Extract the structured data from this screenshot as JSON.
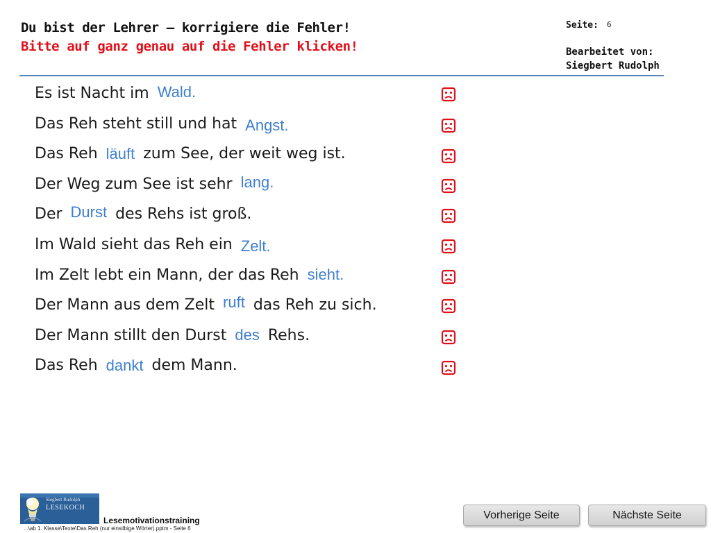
{
  "header": {
    "title": "Du bist der Lehrer – korrigiere die Fehler!",
    "subtitle": "Bitte auf ganz genau auf die Fehler klicken!",
    "page_label": "Seite:",
    "page_number": "6",
    "editor_label": "Bearbeitet von:",
    "editor_name": "Siegbert Rudolph"
  },
  "sentences": [
    {
      "before": "Es ist Nacht im",
      "word": "Wald.",
      "after": "",
      "mark": "sad-face-icon"
    },
    {
      "before": "Das Reh steht still und hat",
      "word": "Angst.",
      "after": "",
      "mark": "sad-face-icon"
    },
    {
      "before": "Das Reh",
      "word": "läuft",
      "after": "zum See, der weit weg ist.",
      "mark": "sad-face-icon"
    },
    {
      "before": "Der Weg zum See ist sehr",
      "word": "lang.",
      "after": "",
      "mark": "sad-face-icon"
    },
    {
      "before": "Der",
      "word": "Durst",
      "after": "des Rehs ist groß.",
      "mark": "sad-face-icon"
    },
    {
      "before": "Im Wald sieht das Reh ein",
      "word": "Zelt.",
      "after": "",
      "mark": "sad-face-icon"
    },
    {
      "before": "Im Zelt lebt ein Mann, der das Reh",
      "word": "sieht.",
      "after": "",
      "mark": "sad-face-icon"
    },
    {
      "before": "Der Mann aus dem Zelt",
      "word": "ruft",
      "after": "das Reh zu sich.",
      "mark": "sad-face-icon"
    },
    {
      "before": "Der Mann stillt den Durst",
      "word": "des",
      "after": "Rehs.",
      "mark": "sad-face-icon"
    },
    {
      "before": "Das Reh",
      "word": "dankt",
      "after": "dem Mann.",
      "mark": "sad-face-icon"
    }
  ],
  "footer": {
    "logo_small": "Siegbert Rudolph",
    "logo_big": "LESEKOCH",
    "title": "Lesemotivationstraining",
    "path": "...\\ab 1. Klasse\\Texte\\Das Reh (nur einsilbige Wörter).pptm - Seite 6",
    "prev_label": "Vorherige Seite",
    "next_label": "Nächste Seite"
  },
  "colors": {
    "title_red": "#e0101a",
    "word_blue": "#3f7fcf",
    "rule_blue": "#5b86b8",
    "smiley_red": "#e0101a",
    "logo_blue": "#2a5f97"
  }
}
